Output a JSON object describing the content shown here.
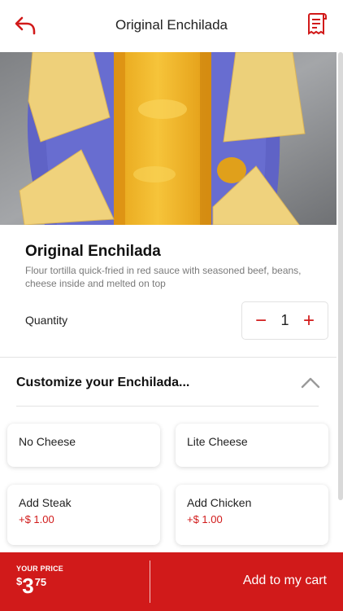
{
  "header": {
    "title": "Original Enchilada",
    "back_icon": "back-arrow-icon",
    "receipt_icon": "receipt-icon",
    "accent_color": "#d11a1a"
  },
  "item": {
    "name": "Original Enchilada",
    "description": "Flour tortilla quick-fried in red sauce with seasoned beef, beans, cheese inside and melted on top"
  },
  "quantity": {
    "label": "Quantity",
    "value": "1",
    "minus": "−",
    "plus": "+"
  },
  "customize": {
    "title": "Customize your Enchilada...",
    "options": [
      {
        "label": "No Cheese"
      },
      {
        "label": "Lite Cheese"
      },
      {
        "label": "Add Steak",
        "price": "+$ 1.00"
      },
      {
        "label": "Add Chicken",
        "price": "+$ 1.00"
      }
    ]
  },
  "footer": {
    "your_price_label": "YOUR PRICE",
    "currency": "$",
    "dollars": "3",
    "cents": "75",
    "add_to_cart": "Add to my cart"
  }
}
